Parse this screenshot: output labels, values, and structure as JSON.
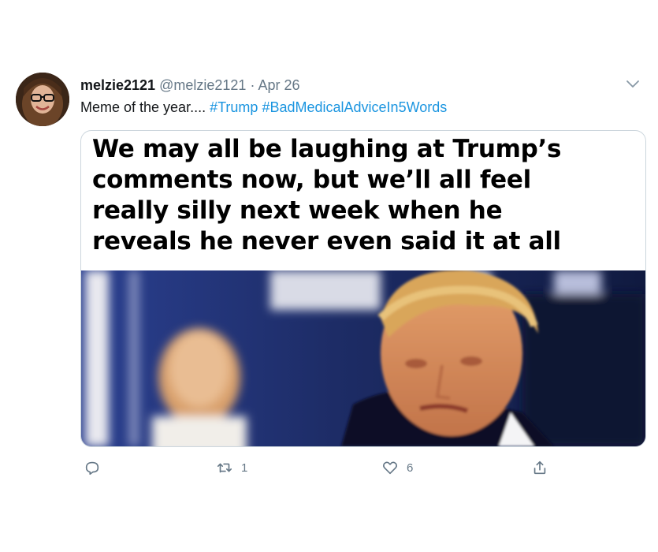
{
  "tweet": {
    "display_name": "melzie2121",
    "handle": "@melzie2121",
    "separator": "·",
    "date": "Apr 26",
    "text_plain": "Meme of the year....",
    "hashtag_1": "#Trump",
    "hashtag_2": "#BadMedicalAdviceIn5Words"
  },
  "media": {
    "caption_lines": [
      "We may all be laughing at Trump’s",
      "comments now, but we’ll all feel",
      "really silly next week when he",
      "reveals he never even said it at all"
    ]
  },
  "actions": {
    "reply_icon": "reply-icon",
    "retweet_icon": "retweet-icon",
    "retweet_count": "1",
    "like_icon": "heart-icon",
    "like_count": "6",
    "share_icon": "share-icon"
  },
  "colors": {
    "link": "#1b95e0",
    "muted": "#657786",
    "text": "#14171a",
    "border": "#ccd6dd"
  }
}
